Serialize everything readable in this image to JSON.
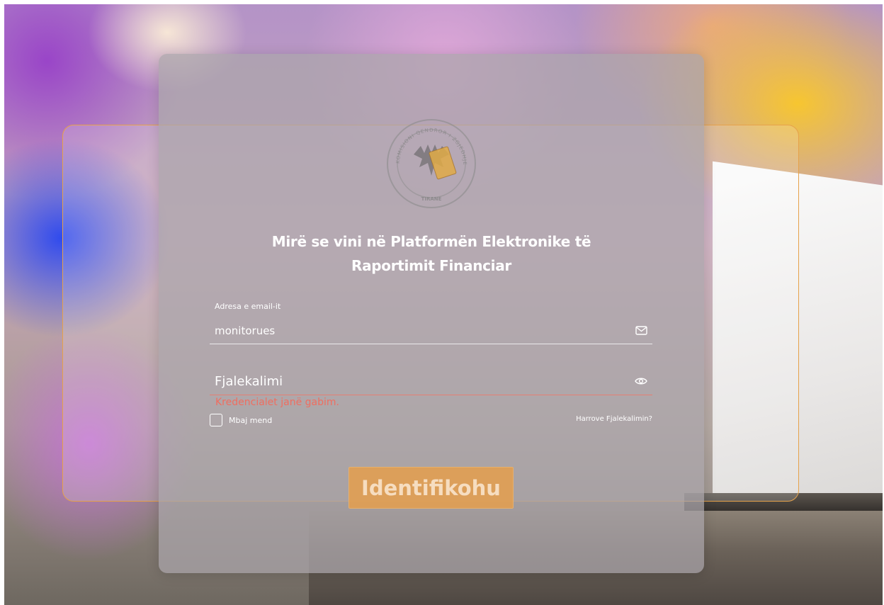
{
  "seal": {
    "top_text": "KOMISIONI QENDROR I ZGJEDHJEVE",
    "bottom_text": "TIRANE"
  },
  "title": {
    "line1": "Mirë se vini në Platformën Elektronike të",
    "line2": "Raportimit Financiar"
  },
  "email": {
    "label": "Adresa e email-it",
    "value": "monitorues",
    "icon": "mail-icon"
  },
  "password": {
    "placeholder": "Fjalekalimi",
    "value": "",
    "icon": "eye-icon"
  },
  "error": {
    "message": "Kredencialet janë gabim.",
    "color": "#ef6e60"
  },
  "remember": {
    "label": "Mbaj mend",
    "checked": false
  },
  "forgot": {
    "label": "Harrove Fjalekalimin?"
  },
  "login": {
    "label": "Identifikohu",
    "color": "#e29e50"
  },
  "colors": {
    "accent": "#e6a24b",
    "card": "#aaa5aa"
  }
}
